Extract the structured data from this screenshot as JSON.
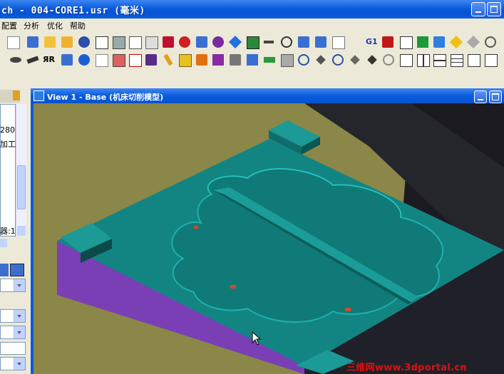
{
  "window": {
    "title": "ch - 004-CORE1.usr (毫米)"
  },
  "menu": {
    "items": [
      "配置",
      "分析",
      "优化",
      "帮助"
    ]
  },
  "toolbar": {
    "g1_label": "G1",
    "rr_label": "ЯR"
  },
  "left_panel": {
    "lines": [
      "280,",
      "加工:",
      "器:1,"
    ]
  },
  "view": {
    "title": "View 1 - Base (机床切削模型)"
  },
  "watermark": {
    "text": "三维网www.3dportal.cn"
  },
  "colors": {
    "title_blue": "#0a5bdc",
    "model_teal": "#128583",
    "model_side": "#7a3fb5",
    "background_olive": "#8a8748"
  }
}
